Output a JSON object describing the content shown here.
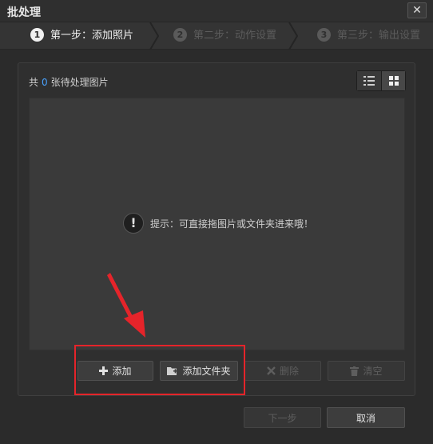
{
  "window": {
    "title": "批处理",
    "close_label": "✕"
  },
  "steps": [
    {
      "num": "1",
      "label": "第一步：添加照片",
      "state": "active"
    },
    {
      "num": "2",
      "label": "第二步：动作设置",
      "state": "inactive"
    },
    {
      "num": "3",
      "label": "第三步：输出设置",
      "state": "inactive"
    }
  ],
  "summary": {
    "prefix": "共",
    "count": "0",
    "suffix": "张待处理图片"
  },
  "view_toggle": {
    "list_icon": "list-view-icon",
    "grid_icon": "grid-view-icon"
  },
  "hint": {
    "icon": "!",
    "text": "提示：可直接拖图片或文件夹进来哦！"
  },
  "buttons": {
    "add": "添加",
    "add_folder": "添加文件夹",
    "delete": "删除",
    "clear": "清空",
    "next": "下一步",
    "cancel": "取消"
  },
  "colors": {
    "accent": "#4aa3ff",
    "highlight": "#e5242a",
    "background": "#2b2b2b"
  }
}
